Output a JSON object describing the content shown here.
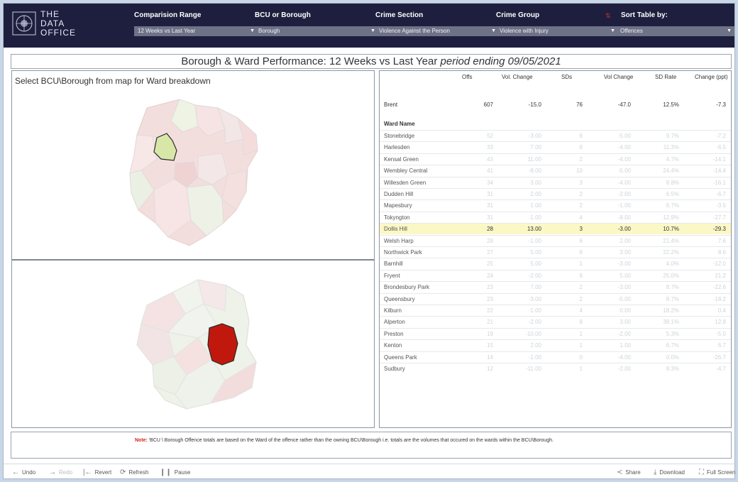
{
  "brand": {
    "line1": "THE",
    "line2": "DATA",
    "line3": "OFFICE"
  },
  "filters": [
    {
      "label": "Comparision Range",
      "value": "12 Weeks vs Last Year"
    },
    {
      "label": "BCU or Borough",
      "value": "Borough"
    },
    {
      "label": "Crime Section",
      "value": "Violence Against the Person"
    },
    {
      "label": "Crime Group",
      "value": "Violence with Injury"
    },
    {
      "label": "Sort Table by:",
      "value": "Offences"
    }
  ],
  "title": {
    "main": "Borough & Ward Performance: 12 Weeks vs Last Year",
    "period": "period ending 09/05/2021"
  },
  "map": {
    "instruction": "Select BCU\\Borough from map for Ward breakdown",
    "selected_color": "#c0180d",
    "borough_color": "#d8e7a8"
  },
  "table": {
    "headers": [
      "Offs",
      "Vol. Change",
      "SDs",
      "Vol Change",
      "SD Rate",
      "Change (ppt)"
    ],
    "summary": {
      "name": "Brent",
      "offs": "607",
      "vol_change": "-15.0",
      "sds": "76",
      "sd_vol_change": "-47.0",
      "sd_rate": "12.5%",
      "change_ppt": "-7.3"
    },
    "ward_header": "Ward Name",
    "wards": [
      {
        "name": "Stonebridge",
        "offs": "52",
        "vol": "-3.00",
        "sds": "6",
        "sdvol": "-5.00",
        "rate": "9.7%",
        "ppt": "-7.2"
      },
      {
        "name": "Harlesden",
        "offs": "33",
        "vol": "7.00",
        "sds": "6",
        "sdvol": "-4.00",
        "rate": "11.3%",
        "ppt": "-6.5"
      },
      {
        "name": "Kensal Green",
        "offs": "43",
        "vol": "11.00",
        "sds": "2",
        "sdvol": "-4.00",
        "rate": "4.7%",
        "ppt": "-14.1"
      },
      {
        "name": "Wembley Central",
        "offs": "41",
        "vol": "-8.00",
        "sds": "10",
        "sdvol": "-5.00",
        "rate": "24.4%",
        "ppt": "-14.4"
      },
      {
        "name": "Willesden Green",
        "offs": "34",
        "vol": "3.00",
        "sds": "3",
        "sdvol": "-4.00",
        "rate": "8.8%",
        "ppt": "-16.1"
      },
      {
        "name": "Dudden Hill",
        "offs": "31",
        "vol": "2.00",
        "sds": "2",
        "sdvol": "-2.00",
        "rate": "6.5%",
        "ppt": "-6.7"
      },
      {
        "name": "Mapesbury",
        "offs": "31",
        "vol": "1.00",
        "sds": "2",
        "sdvol": "-1.00",
        "rate": "6.7%",
        "ppt": "-3.5"
      },
      {
        "name": "Tokyngton",
        "offs": "31",
        "vol": "-1.00",
        "sds": "4",
        "sdvol": "-8.00",
        "rate": "12.9%",
        "ppt": "-27.7"
      },
      {
        "name": "Dollis Hill",
        "offs": "28",
        "vol": "13.00",
        "sds": "3",
        "sdvol": "-3.00",
        "rate": "10.7%",
        "ppt": "-29.3"
      },
      {
        "name": "Welsh Harp",
        "offs": "28",
        "vol": "-1.00",
        "sds": "6",
        "sdvol": "2.00",
        "rate": "21.4%",
        "ppt": "7.6"
      },
      {
        "name": "Northwick Park",
        "offs": "27",
        "vol": "5.00",
        "sds": "6",
        "sdvol": "3.00",
        "rate": "22.2%",
        "ppt": "8.6"
      },
      {
        "name": "Barnhill",
        "offs": "25",
        "vol": "5.00",
        "sds": "1",
        "sdvol": "-3.00",
        "rate": "4.0%",
        "ppt": "-12.0"
      },
      {
        "name": "Fryent",
        "offs": "24",
        "vol": "-2.00",
        "sds": "6",
        "sdvol": "5.00",
        "rate": "25.0%",
        "ppt": "21.2"
      },
      {
        "name": "Brondesbury Park",
        "offs": "23",
        "vol": "7.00",
        "sds": "2",
        "sdvol": "-3.00",
        "rate": "8.7%",
        "ppt": "-22.6"
      },
      {
        "name": "Queensbury",
        "offs": "23",
        "vol": "-3.00",
        "sds": "2",
        "sdvol": "-5.00",
        "rate": "8.7%",
        "ppt": "-18.2"
      },
      {
        "name": "Kilburn",
        "offs": "22",
        "vol": "-1.00",
        "sds": "4",
        "sdvol": "0.00",
        "rate": "18.2%",
        "ppt": "0.4"
      },
      {
        "name": "Alperton",
        "offs": "21",
        "vol": "-2.00",
        "sds": "8",
        "sdvol": "3.00",
        "rate": "38.1%",
        "ppt": "12.8"
      },
      {
        "name": "Preston",
        "offs": "19",
        "vol": "-10.00",
        "sds": "1",
        "sdvol": "-2.00",
        "rate": "5.3%",
        "ppt": "-5.0"
      },
      {
        "name": "Kenton",
        "offs": "15",
        "vol": "2.00",
        "sds": "1",
        "sdvol": "1.00",
        "rate": "6.7%",
        "ppt": "6.7"
      },
      {
        "name": "Queens Park",
        "offs": "14",
        "vol": "-1.00",
        "sds": "0",
        "sdvol": "-4.00",
        "rate": "0.0%",
        "ppt": "-26.7"
      },
      {
        "name": "Sudbury",
        "offs": "12",
        "vol": "-11.00",
        "sds": "1",
        "sdvol": "-2.00",
        "rate": "8.3%",
        "ppt": "-4.7"
      }
    ]
  },
  "note": {
    "label": "Note:",
    "text": "'BCU \\ Borough Offence totals are based on the Ward of the offence rather than the owning BCU\\Borough i.e. totals are the volumes that occured on the wards within the BCU\\Borough."
  },
  "toolbar": {
    "undo": "Undo",
    "redo": "Redo",
    "revert": "Revert",
    "refresh": "Refresh",
    "pause": "Pause",
    "share": "Share",
    "download": "Download",
    "fullscreen": "Full Screen"
  }
}
